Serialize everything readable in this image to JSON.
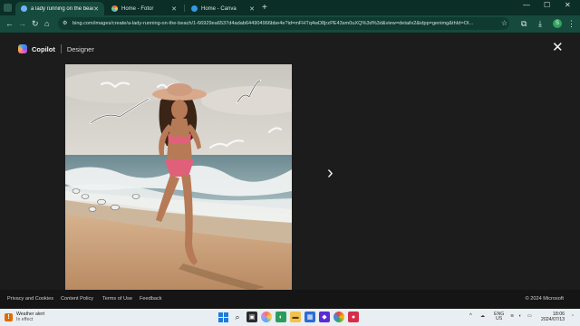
{
  "browser": {
    "tabs": [
      {
        "label": "a lady running on the beach - Se",
        "active": true
      },
      {
        "label": "Home - Fotor",
        "active": false
      },
      {
        "label": "Home - Canva",
        "active": false
      }
    ],
    "address": "bing.com/images/create/a-lady-running-on-the-beach/1-66929ea6537d4adab644904966bbe4e?id=mFHTq4wD8jrzPE43sm0uXQ%3d%3d&view=detailv2&idpp=genimg&thId=OI...",
    "profile_initial": "S",
    "accent": "#164a3d"
  },
  "page": {
    "brand": "Copilot",
    "section": "Designer",
    "close_icon": "✕",
    "next_icon": "›",
    "image_alt_subject": "lady running on the beach"
  },
  "footer": {
    "links": [
      "Privacy and Cookies",
      "Content Policy",
      "Terms of Use",
      "Feedback"
    ],
    "copyright": "© 2024 Microsoft"
  },
  "taskbar": {
    "weather_title": "Weather alert",
    "weather_sub": "In effect",
    "lang_top": "ENG",
    "lang_bottom": "US",
    "time": "18:06",
    "date": "2024/07/13"
  }
}
